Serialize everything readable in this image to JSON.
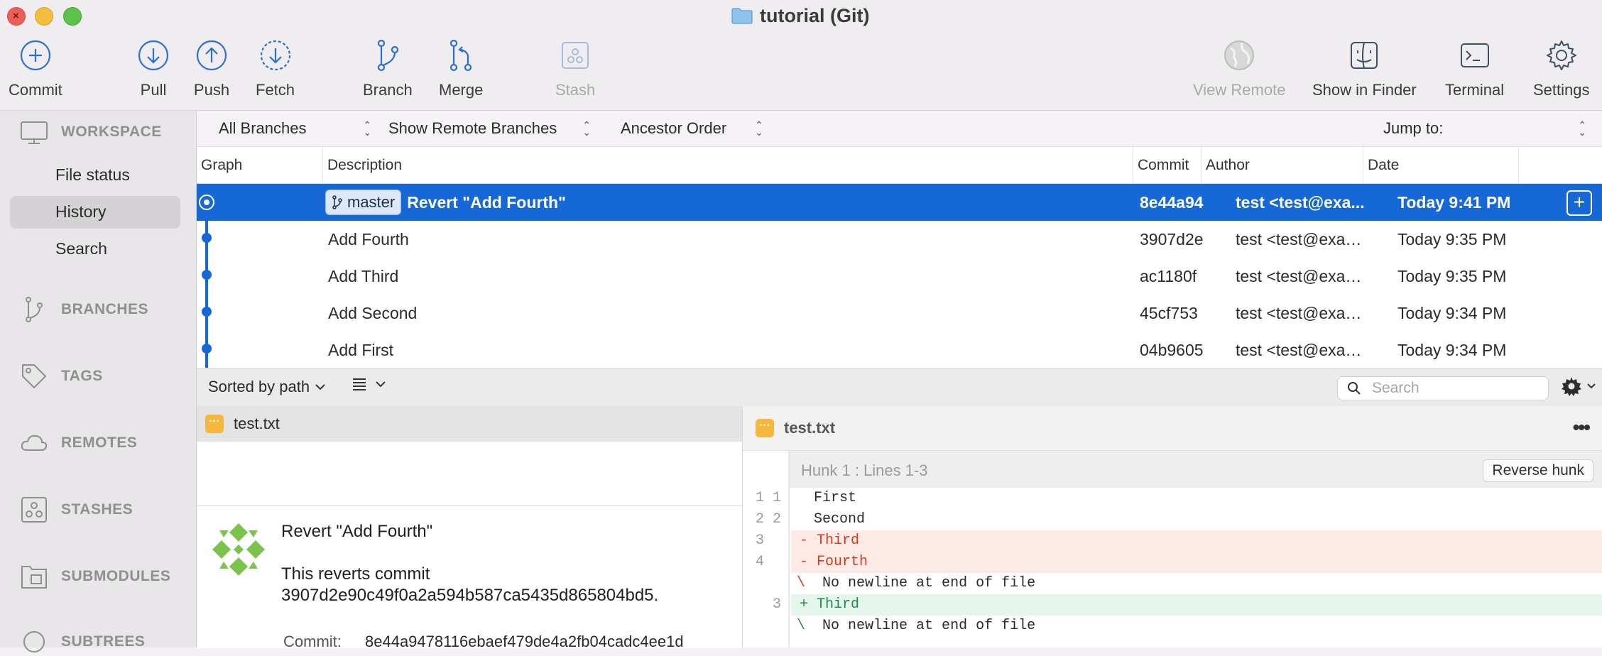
{
  "window": {
    "title": "tutorial (Git)"
  },
  "toolbar": {
    "commit": "Commit",
    "pull": "Pull",
    "push": "Push",
    "fetch": "Fetch",
    "branch": "Branch",
    "merge": "Merge",
    "stash": "Stash",
    "view_remote": "View Remote",
    "show_in_finder": "Show in Finder",
    "terminal": "Terminal",
    "settings": "Settings"
  },
  "sidebar": {
    "workspace": "WORKSPACE",
    "items": [
      "File status",
      "History",
      "Search"
    ],
    "branches": "BRANCHES",
    "tags": "TAGS",
    "remotes": "REMOTES",
    "stashes": "STASHES",
    "submodules": "SUBMODULES",
    "subtrees": "SUBTREES"
  },
  "filters": {
    "branches": "All Branches",
    "remote": "Show Remote Branches",
    "order": "Ancestor Order",
    "jump": "Jump to:"
  },
  "table": {
    "headers": {
      "graph": "Graph",
      "description": "Description",
      "commit": "Commit",
      "author": "Author",
      "date": "Date"
    },
    "branch_badge": "master",
    "rows": [
      {
        "desc": "Revert \"Add Fourth\"",
        "hash": "8e44a94",
        "author": "test <test@exa...",
        "date": "Today 9:41 PM"
      },
      {
        "desc": "Add Fourth",
        "hash": "3907d2e",
        "author": "test <test@exam...",
        "date": "Today 9:35 PM"
      },
      {
        "desc": "Add Third",
        "hash": "ac1180f",
        "author": "test <test@exam...",
        "date": "Today 9:35 PM"
      },
      {
        "desc": "Add Second",
        "hash": "45cf753",
        "author": "test <test@exam...",
        "date": "Today 9:34 PM"
      },
      {
        "desc": "Add First",
        "hash": "04b9605",
        "author": "test <test@exam...",
        "date": "Today 9:34 PM"
      }
    ]
  },
  "lower": {
    "sort": "Sorted by path",
    "search_placeholder": "Search"
  },
  "files": {
    "name": "test.txt"
  },
  "commit_detail": {
    "title": "Revert \"Add Fourth\"",
    "body1": "This reverts commit",
    "body2": "3907d2e90c49f0a2a594b587ca5435d865804bd5.",
    "commit_label": "Commit:",
    "commit_value": "8e44a9478116ebaef479de4a2fb04cadc4ee1d"
  },
  "diff": {
    "file": "test.txt",
    "hunk": "Hunk 1 : Lines 1-3",
    "reverse": "Reverse hunk",
    "lines": [
      {
        "old": "1",
        "new": "1",
        "sign": " ",
        "text": "First"
      },
      {
        "old": "2",
        "new": "2",
        "sign": " ",
        "text": "Second"
      },
      {
        "old": "3",
        "new": "",
        "sign": "-",
        "text": "Third"
      },
      {
        "old": "4",
        "new": "",
        "sign": "-",
        "text": "Fourth"
      },
      {
        "old": "",
        "new": "",
        "sign": "\\",
        "text": " No newline at end of file"
      },
      {
        "old": "",
        "new": "3",
        "sign": "+",
        "text": "Third"
      },
      {
        "old": "",
        "new": "",
        "sign": "\\",
        "text": " No newline at end of file"
      }
    ]
  },
  "colors": {
    "accent": "#1568d6",
    "deleted": "#d23a1a",
    "added": "#1d8a4a"
  }
}
